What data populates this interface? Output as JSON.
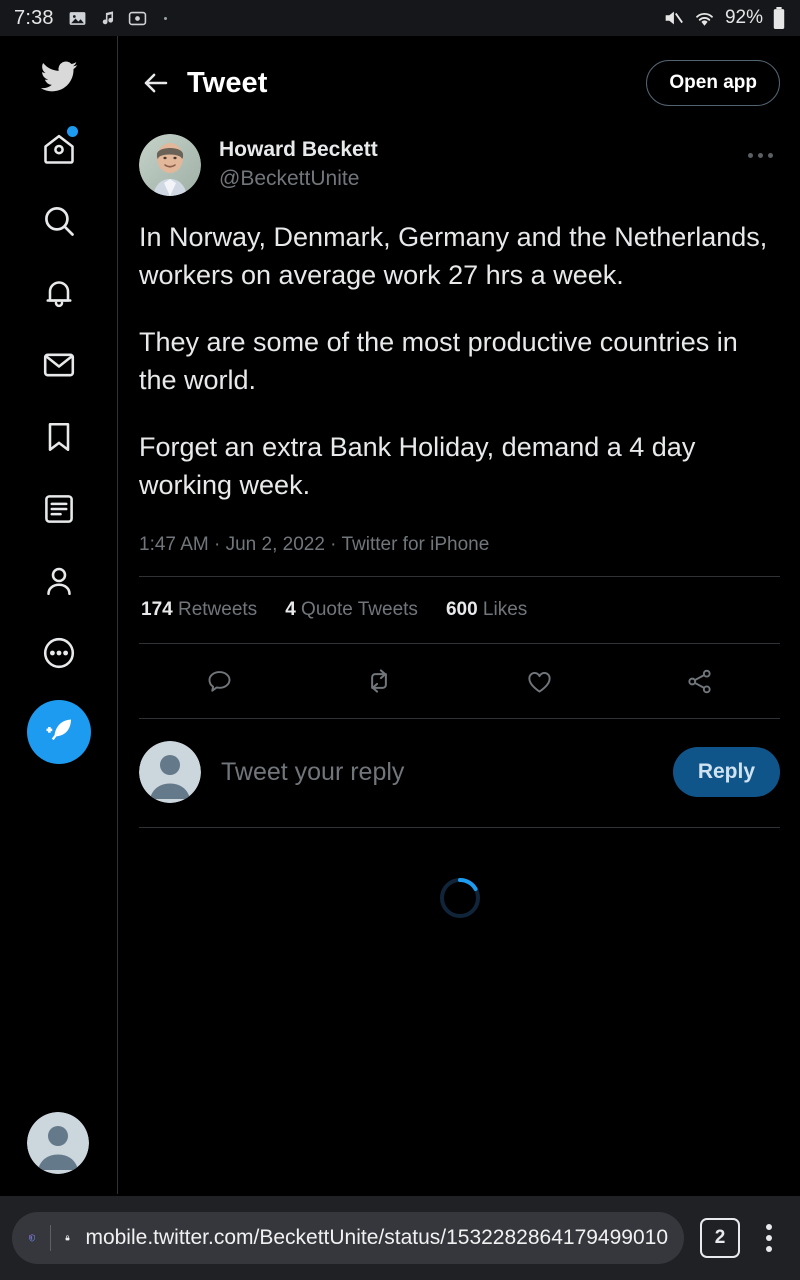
{
  "status_bar": {
    "time": "7:38",
    "battery": "92%",
    "left_icons": [
      "image-icon",
      "music-note-icon",
      "screen-record-icon",
      "small-dot-icon"
    ],
    "right_icons": [
      "mute-icon",
      "wifi-icon",
      "battery-icon"
    ]
  },
  "sidebar": {
    "items": [
      {
        "name": "twitter-logo",
        "label": "Twitter"
      },
      {
        "name": "home",
        "label": "Home",
        "badge": true
      },
      {
        "name": "search",
        "label": "Search"
      },
      {
        "name": "notifications",
        "label": "Notifications"
      },
      {
        "name": "messages",
        "label": "Messages"
      },
      {
        "name": "bookmarks",
        "label": "Bookmarks"
      },
      {
        "name": "lists",
        "label": "Lists"
      },
      {
        "name": "profile",
        "label": "Profile"
      },
      {
        "name": "more",
        "label": "More"
      }
    ],
    "compose_label": "Tweet",
    "account_avatar": "default-avatar"
  },
  "header": {
    "back_label": "Back",
    "title": "Tweet",
    "open_app_label": "Open app"
  },
  "tweet": {
    "author_name": "Howard Beckett",
    "author_handle": "@BeckettUnite",
    "more_label": "More",
    "paragraphs": [
      "In Norway, Denmark, Germany and the Netherlands, workers on average work 27 hrs a week.",
      "They are some of the most productive countries in the world.",
      "Forget an extra Bank Holiday, demand a 4 day working week."
    ],
    "meta": "1:47 AM · Jun 2, 2022 · Twitter for iPhone",
    "stats": [
      {
        "count": "174",
        "label": "Retweets"
      },
      {
        "count": "4",
        "label": "Quote Tweets"
      },
      {
        "count": "600",
        "label": "Likes"
      }
    ],
    "actions": [
      {
        "name": "reply-icon",
        "label": "Reply"
      },
      {
        "name": "retweet-icon",
        "label": "Retweet"
      },
      {
        "name": "like-icon",
        "label": "Like"
      },
      {
        "name": "share-icon",
        "label": "Share"
      }
    ]
  },
  "reply_composer": {
    "placeholder": "Tweet your reply",
    "button_label": "Reply",
    "avatar": "default-avatar"
  },
  "loading": {
    "label": "Loading replies",
    "spinner_color": "#1d9bf0",
    "track_color": "#10253a"
  },
  "browser": {
    "url": "mobile.twitter.com/BeckettUnite/status/1532282864179499010",
    "shield_icon": "brave-shield-icon",
    "lock_icon": "lock-icon",
    "tab_count": "2",
    "menu_icon": "kebab-menu-icon"
  },
  "colors": {
    "accent": "#1d9bf0",
    "background": "#000000",
    "text_primary": "#e7e9ea",
    "text_secondary": "#71767b",
    "divider": "#2f3336",
    "browser_bar": "#1f2125"
  }
}
